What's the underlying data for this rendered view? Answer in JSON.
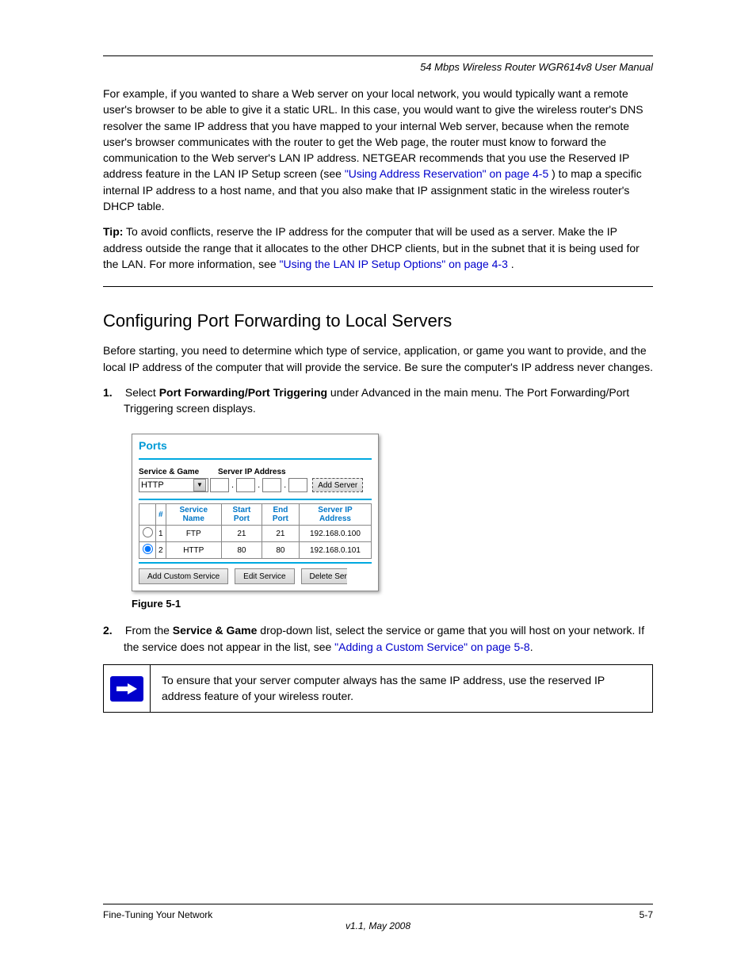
{
  "header": {
    "doc_title": "54 Mbps Wireless Router WGR614v8 User Manual"
  },
  "paragraphs": {
    "intro1": "For example, if you wanted to share a Web server on your local network, you would typically want a remote user's browser to be able to give it a static URL. In this case, you would want to give the wireless router's DNS resolver the same IP address that you have mapped to your internal Web server, because when the remote user's browser communicates with the router to get the Web page, the router must know to forward the communication to the Web server's LAN IP address. NETGEAR recommends that you use the Reserved IP address feature in the LAN IP Setup screen (see ",
    "intro_link": "\"Using Address Reservation\" on page 4-5",
    "intro_after": ") to map a specific internal IP address to a host name, and that you also make that IP assignment static in the wireless router's DHCP table.",
    "tip": "To avoid conflicts, reserve the IP address for the computer that will be used as a server. Make the IP address outside the range that it allocates to the other DHCP clients, but in the subnet that it is being used for the LAN. For more information, see ",
    "tip_label": "Tip:",
    "tip_link": "\"Using the LAN IP Setup Options\" on page 4-3",
    "tip_after": "."
  },
  "section": {
    "heading": "Configuring Port Forwarding to Local Servers",
    "p1": "Before starting, you need to determine which type of service, application, or game you want to provide, and the local IP address of the computer that will provide the service. Be sure the computer's IP address never changes.",
    "step1_num": "1.",
    "step1_text_a": "Select ",
    "step1_bold": "Port Forwarding/Port Triggering",
    "step1_text_b": " under Advanced in the main menu. The Port Forwarding/Port Triggering screen displays.",
    "fig_caption": "Figure 5-1",
    "step2_num": "2.",
    "step2_text_a": "From the ",
    "step2_bold1": "Service & Game",
    "step2_text_b": " drop-down list, select the service or game that you will host on your network. If the service does not appear in the list, see ",
    "step2_link": "\"Adding a Custom Service\" on page 5-8",
    "step2_text_c": "."
  },
  "note": {
    "text": "To ensure that your server computer always has the same IP address, use the reserved IP address feature of your wireless router."
  },
  "footer": {
    "left": "Fine-Tuning Your Network",
    "right": "5-7",
    "center": "v1.1, May 2008"
  },
  "ports_panel": {
    "title": "Ports",
    "label_service": "Service & Game",
    "label_ip": "Server IP Address",
    "select_value": "HTTP",
    "add_server": "Add Server",
    "headers": {
      "num": "#",
      "service": "Service Name",
      "start": "Start Port",
      "end": "End Port",
      "ip": "Server IP Address"
    },
    "rows": [
      {
        "selected": false,
        "num": "1",
        "service": "FTP",
        "start": "21",
        "end": "21",
        "ip": "192.168.0.100"
      },
      {
        "selected": true,
        "num": "2",
        "service": "HTTP",
        "start": "80",
        "end": "80",
        "ip": "192.168.0.101"
      }
    ],
    "btn_add_custom": "Add Custom Service",
    "btn_edit": "Edit Service",
    "btn_delete": "Delete Ser"
  }
}
